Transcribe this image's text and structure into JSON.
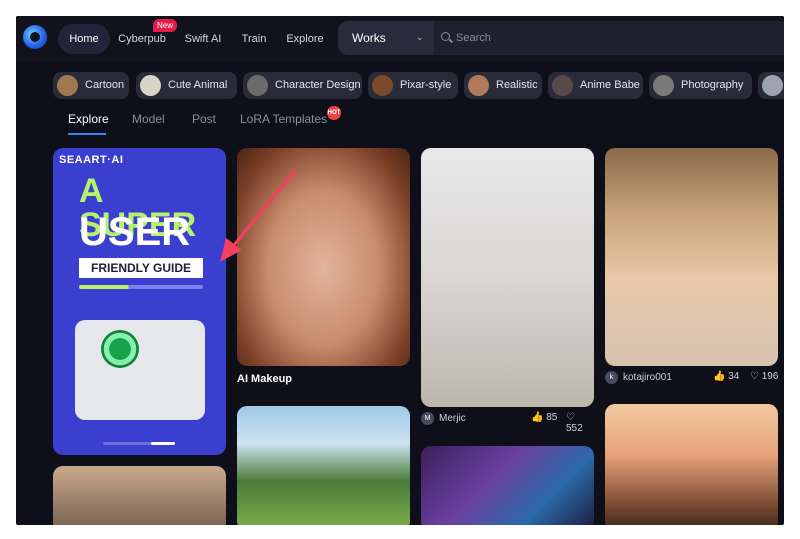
{
  "nav": {
    "items": [
      "Home",
      "Cyberpub",
      "Swift AI",
      "Train",
      "Explore"
    ],
    "new_badge": "New",
    "works": "Works",
    "search_placeholder": "Search"
  },
  "chips": [
    "Cartoon",
    "Cute Animal",
    "Character Design",
    "Pixar-style",
    "Realistic",
    "Anime Babe",
    "Photography"
  ],
  "tabs": [
    "Explore",
    "Model",
    "Post",
    "LoRA Templates"
  ],
  "hot_badge": "HOT",
  "promo": {
    "brand": "SEAART·AI",
    "line1": "A SUPER",
    "line2": "USER",
    "line3": "FRIENDLY GUIDE"
  },
  "cards": {
    "ai_makeup": {
      "caption": "AI Makeup"
    },
    "merjic": {
      "user": "Merjic",
      "initial": "M",
      "likes": "85",
      "hearts": "552"
    },
    "kotajiro": {
      "user": "kotajiro001",
      "initial": "k",
      "likes": "34",
      "hearts": "196"
    }
  },
  "colors": {
    "accent": "#3b82f6",
    "annotation_arrow": "#f43f5e",
    "background": "#0f0f1a"
  }
}
